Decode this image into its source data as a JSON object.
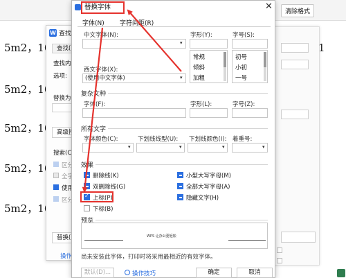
{
  "background_doc": {
    "lines": [
      "5m2，10",
      "5m2，10",
      "5m2，10",
      "5m2，10",
      "5m2，10"
    ],
    "clear_format_button": "清除格式",
    "right_letter": "1"
  },
  "find_replace": {
    "title": "查找和",
    "tab": "查找(D)",
    "find_label": "查找内容",
    "options_label": "选项:",
    "replace_label": "替换为(",
    "advanced_button": "高级搜",
    "search_label": "搜索(C)",
    "checks": [
      {
        "label": "区分",
        "checked": true,
        "enabled": false
      },
      {
        "label": "全字",
        "checked": false,
        "enabled": false
      },
      {
        "label": "使用",
        "checked": true,
        "enabled": true
      },
      {
        "label": "区分",
        "checked": true,
        "enabled": false
      }
    ],
    "replace_button": "替换(",
    "tips_link": "操作"
  },
  "font_dialog": {
    "title": "替换字体",
    "close": "✕",
    "tabs": [
      "字体(N)",
      "字符间距(R)"
    ],
    "chinese_font_label": "中文字体(N):",
    "chinese_font_value": "",
    "western_font_label": "西文字体(X):",
    "western_font_value": "(使用中文字体)",
    "style_label": "字形(Y):",
    "style_value": "",
    "style_options": [
      "常规",
      "倾斜",
      "加粗"
    ],
    "size_label": "字号(S):",
    "size_value": "",
    "size_options": [
      "初号",
      "小初",
      "一号"
    ],
    "complex_group": "复杂文种",
    "complex_font_label": "字体(F):",
    "complex_style_label": "字形(L):",
    "complex_size_label": "字号(Z):",
    "all_text_group": "所有文字",
    "font_color_label": "字体颜色(C):",
    "underline_type_label": "下划线线型(U):",
    "underline_color_label": "下划线颜色(I):",
    "emphasis_label": "着重号:",
    "effects_group": "效果",
    "effects_left": [
      {
        "label": "删除线(K)",
        "state": "partial"
      },
      {
        "label": "双删除线(G)",
        "state": "partial"
      },
      {
        "label": "上标(P)",
        "state": "checked"
      },
      {
        "label": "下标(B)",
        "state": "unchecked"
      }
    ],
    "effects_right": [
      {
        "label": "小型大写字母(M)",
        "state": "partial"
      },
      {
        "label": "全部大写字母(A)",
        "state": "partial"
      },
      {
        "label": "隐藏文字(H)",
        "state": "partial"
      }
    ],
    "preview_group": "预览",
    "preview_text": "WPS 让办公更轻松",
    "note": "尚未安装此字体，打印时将采用最相近的有效字体。",
    "default_button": "默认(D)...",
    "tips_link": "操作技巧",
    "ok_button": "确定",
    "cancel_button": "取消"
  },
  "colors": {
    "annotation": "#e5322d",
    "accent": "#2b6fe0"
  }
}
